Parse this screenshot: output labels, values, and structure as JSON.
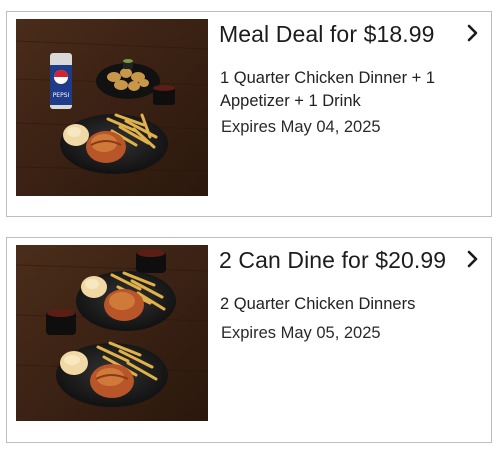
{
  "colors": {
    "border": "#bdbdbd",
    "text": "#1c1c1c",
    "background": "#ffffff"
  },
  "deals": [
    {
      "title": "Meal Deal for $18.99",
      "description": "1 Quarter Chicken Dinner + 1 Appetizer + 1 Drink",
      "expires": "Expires May 04, 2025",
      "image": "meal-deal-photo",
      "chevron_icon": "chevron-right-icon"
    },
    {
      "title": "2 Can Dine for $20.99",
      "description": "2 Quarter Chicken Dinners",
      "expires": "Expires May 05, 2025",
      "image": "two-can-dine-photo",
      "chevron_icon": "chevron-right-icon"
    }
  ],
  "image_text": {
    "cup_brand": "PEPSI"
  }
}
